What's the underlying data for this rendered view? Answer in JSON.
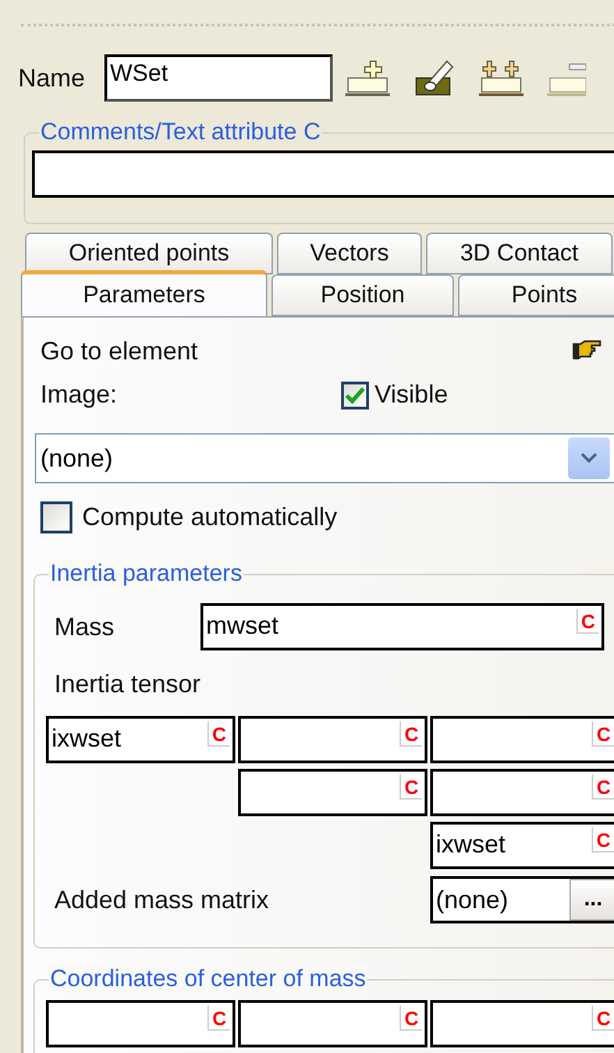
{
  "name_field": {
    "label": "Name",
    "value": "WSet"
  },
  "comments": {
    "legend": "Comments/Text attribute C"
  },
  "tab_rows": [
    [
      {
        "label": "Oriented points",
        "selected": false
      },
      {
        "label": "Vectors",
        "selected": false
      },
      {
        "label": "3D Contact",
        "selected": false
      }
    ],
    [
      {
        "label": "Parameters",
        "selected": true
      },
      {
        "label": "Position",
        "selected": false
      },
      {
        "label": "Points",
        "selected": false
      }
    ]
  ],
  "panel": {
    "goto": "Go to element",
    "image_label": "Image:",
    "visible": {
      "label": "Visible",
      "checked": true
    },
    "image_select": {
      "value": "(none)"
    },
    "compute": {
      "label": "Compute automatically",
      "checked": false
    },
    "inertia": {
      "legend": "Inertia parameters",
      "mass": {
        "label": "Mass",
        "value": "mwset",
        "c": "C"
      },
      "tensor_label": "Inertia tensor",
      "tensor": [
        [
          {
            "value": "ixwset",
            "c": "C"
          },
          {
            "c": "C"
          },
          {
            "c": "C"
          }
        ],
        [
          {
            "c": "C"
          },
          {
            "c": "C"
          }
        ],
        [
          {
            "value": "ixwset",
            "c": "C"
          }
        ]
      ],
      "added_mass": {
        "label": "Added mass matrix",
        "value": "(none)",
        "button": "..."
      }
    },
    "center_of_mass": {
      "legend": "Coordinates of center of mass",
      "fields": [
        {
          "c": "C"
        },
        {
          "c": "C"
        },
        {
          "c": "C"
        }
      ]
    }
  }
}
